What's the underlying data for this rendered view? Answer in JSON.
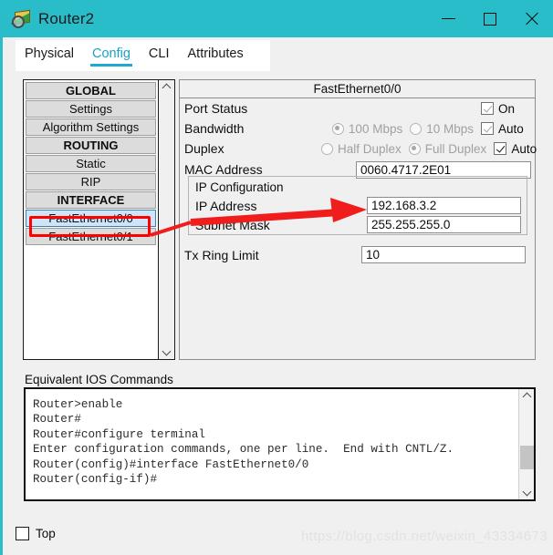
{
  "window": {
    "title": "Router2",
    "icon": "router-magnifier-icon",
    "controls": {
      "minimize": "minimize-icon",
      "maximize": "maximize-icon",
      "close": "close-icon"
    },
    "accent_color": "#29bcc9"
  },
  "tabs": [
    {
      "label": "Physical",
      "active": false
    },
    {
      "label": "Config",
      "active": true
    },
    {
      "label": "CLI",
      "active": false
    },
    {
      "label": "Attributes",
      "active": false
    }
  ],
  "sidebar": {
    "items": [
      {
        "label": "GLOBAL",
        "type": "header"
      },
      {
        "label": "Settings",
        "type": "item"
      },
      {
        "label": "Algorithm Settings",
        "type": "item"
      },
      {
        "label": "ROUTING",
        "type": "header"
      },
      {
        "label": "Static",
        "type": "item"
      },
      {
        "label": "RIP",
        "type": "item"
      },
      {
        "label": "INTERFACE",
        "type": "header"
      },
      {
        "label": "FastEthernet0/0",
        "type": "item",
        "selected": true
      },
      {
        "label": "FastEthernet0/1",
        "type": "item"
      }
    ],
    "scroll_up": "chevron-up-icon",
    "scroll_down": "chevron-down-icon"
  },
  "interface_panel": {
    "title": "FastEthernet0/0",
    "port_status": {
      "label": "Port Status",
      "checkbox_label": "On",
      "checked": true
    },
    "bandwidth": {
      "label": "Bandwidth",
      "option_100": "100 Mbps",
      "option_10": "10 Mbps",
      "selected_option": "100 Mbps",
      "auto_label": "Auto",
      "auto_checked": true
    },
    "duplex": {
      "label": "Duplex",
      "option_half": "Half Duplex",
      "option_full": "Full Duplex",
      "selected_option": "Full Duplex",
      "auto_label": "Auto",
      "auto_checked": true
    },
    "mac_address": {
      "label": "MAC Address",
      "value": "0060.4717.2E01"
    },
    "ip_configuration": {
      "group_title": "IP Configuration",
      "ip_address": {
        "label": "IP Address",
        "value": "192.168.3.2"
      },
      "subnet_mask": {
        "label": "Subnet Mask",
        "value": "255.255.255.0"
      }
    },
    "tx_ring_limit": {
      "label": "Tx Ring Limit",
      "value": "10"
    }
  },
  "annotation": {
    "highlight_color": "#fe0000",
    "arrow_color": "#f01d1d",
    "description": "red-arrow-from-fastethernet00-to-ip-fields"
  },
  "ios": {
    "label": "Equivalent IOS Commands",
    "text": "Router>enable\nRouter#\nRouter#configure terminal\nEnter configuration commands, one per line.  End with CNTL/Z.\nRouter(config)#interface FastEthernet0/0\nRouter(config-if)#",
    "scroll_up": "chevron-up-icon",
    "scroll_down": "chevron-down-icon"
  },
  "bottom": {
    "top_checkbox_label": "Top",
    "top_checked": false,
    "watermark": "https://blog.csdn.net/weixin_43334673"
  }
}
